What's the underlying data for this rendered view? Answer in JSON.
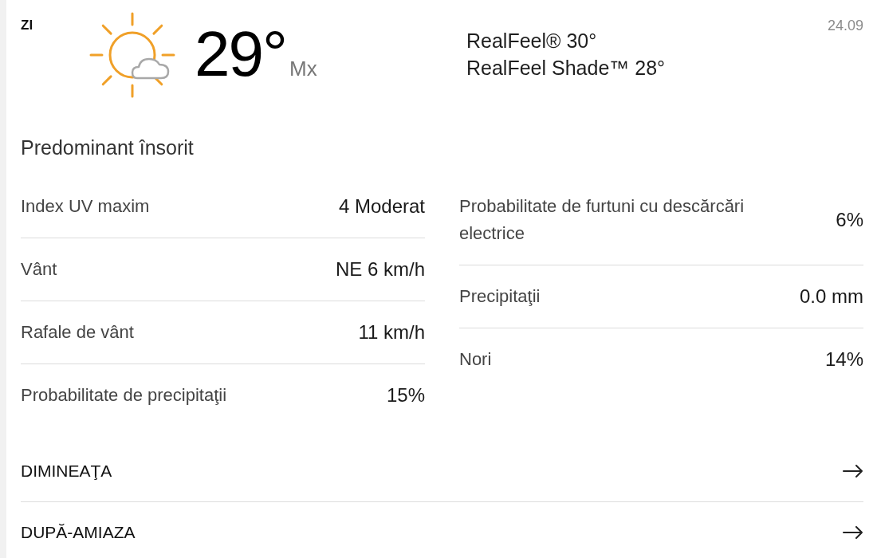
{
  "forecast": {
    "period": "ZI",
    "temperature": "29°",
    "temperature_type": "Mx",
    "realfeel": "RealFeel® 30°",
    "realfeel_shade": "RealFeel Shade™ 28°",
    "date": "24.09",
    "phrase": "Predominant însorit"
  },
  "details_left": [
    {
      "label": "Index UV maxim",
      "value": "4 Moderat"
    },
    {
      "label": "Vânt",
      "value": "NE 6 km/h"
    },
    {
      "label": "Rafale de vânt",
      "value": "11 km/h"
    },
    {
      "label": "Probabilitate de precipitaţii",
      "value": "15%"
    }
  ],
  "details_right": [
    {
      "label": "Probabilitate de furtuni cu descărcări electrice",
      "value": "6%"
    },
    {
      "label": "Precipitaţii",
      "value": "0.0 mm"
    },
    {
      "label": "Nori",
      "value": "14%"
    }
  ],
  "sections": [
    {
      "label": "DIMINEAŢA"
    },
    {
      "label": "DUPĂ-AMIAZA"
    }
  ]
}
